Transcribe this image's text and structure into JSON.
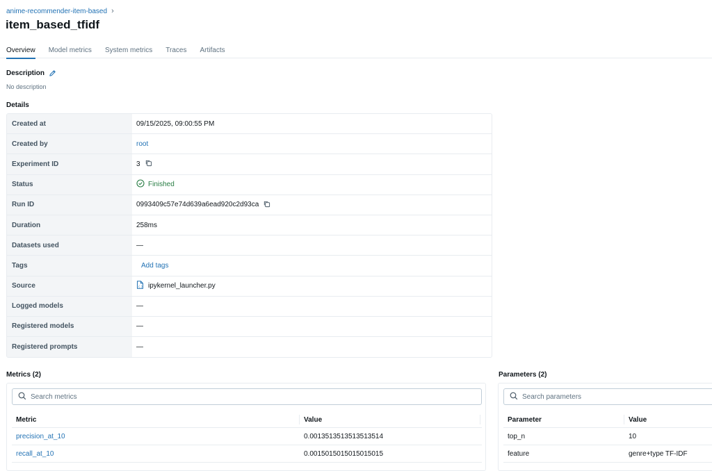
{
  "breadcrumb": {
    "experiment": "anime-recommender-item-based",
    "chevron": "›"
  },
  "page": {
    "title": "item_based_tfidf"
  },
  "tabs": [
    {
      "label": "Overview",
      "active": true
    },
    {
      "label": "Model metrics",
      "active": false
    },
    {
      "label": "System metrics",
      "active": false
    },
    {
      "label": "Traces",
      "active": false
    },
    {
      "label": "Artifacts",
      "active": false
    }
  ],
  "description": {
    "heading": "Description",
    "text": "No description",
    "edit_icon": "pencil-icon"
  },
  "details": {
    "heading": "Details",
    "rows": {
      "created_at": {
        "label": "Created at",
        "value": "09/15/2025, 09:00:55 PM"
      },
      "created_by": {
        "label": "Created by",
        "value": "root"
      },
      "experiment_id": {
        "label": "Experiment ID",
        "value": "3"
      },
      "status": {
        "label": "Status",
        "value": "Finished",
        "color": "#277c43"
      },
      "run_id": {
        "label": "Run ID",
        "value": "0993409c57e74d639a6ead920c2d93ca"
      },
      "duration": {
        "label": "Duration",
        "value": "258ms"
      },
      "datasets_used": {
        "label": "Datasets used",
        "value": "—"
      },
      "tags": {
        "label": "Tags",
        "value": "Add tags"
      },
      "source": {
        "label": "Source",
        "value": "ipykernel_launcher.py"
      },
      "logged_models": {
        "label": "Logged models",
        "value": "—"
      },
      "registered_models": {
        "label": "Registered models",
        "value": "—"
      },
      "registered_prompts": {
        "label": "Registered prompts",
        "value": "—"
      }
    }
  },
  "metrics": {
    "heading": "Metrics (2)",
    "search_placeholder": "Search metrics",
    "columns": [
      "Metric",
      "Value"
    ],
    "rows": [
      {
        "name": "precision_at_10",
        "value": "0.0013513513513513514"
      },
      {
        "name": "recall_at_10",
        "value": "0.0015015015015015015"
      }
    ]
  },
  "parameters": {
    "heading": "Parameters (2)",
    "search_placeholder": "Search parameters",
    "columns": [
      "Parameter",
      "Value"
    ],
    "rows": [
      {
        "name": "top_n",
        "value": "10"
      },
      {
        "name": "feature",
        "value": "genre+type TF-IDF"
      }
    ]
  },
  "colors": {
    "accent": "#2272b4",
    "success": "#277c43",
    "key_bg": "#f3f5f7",
    "border": "#e8ecf0"
  }
}
